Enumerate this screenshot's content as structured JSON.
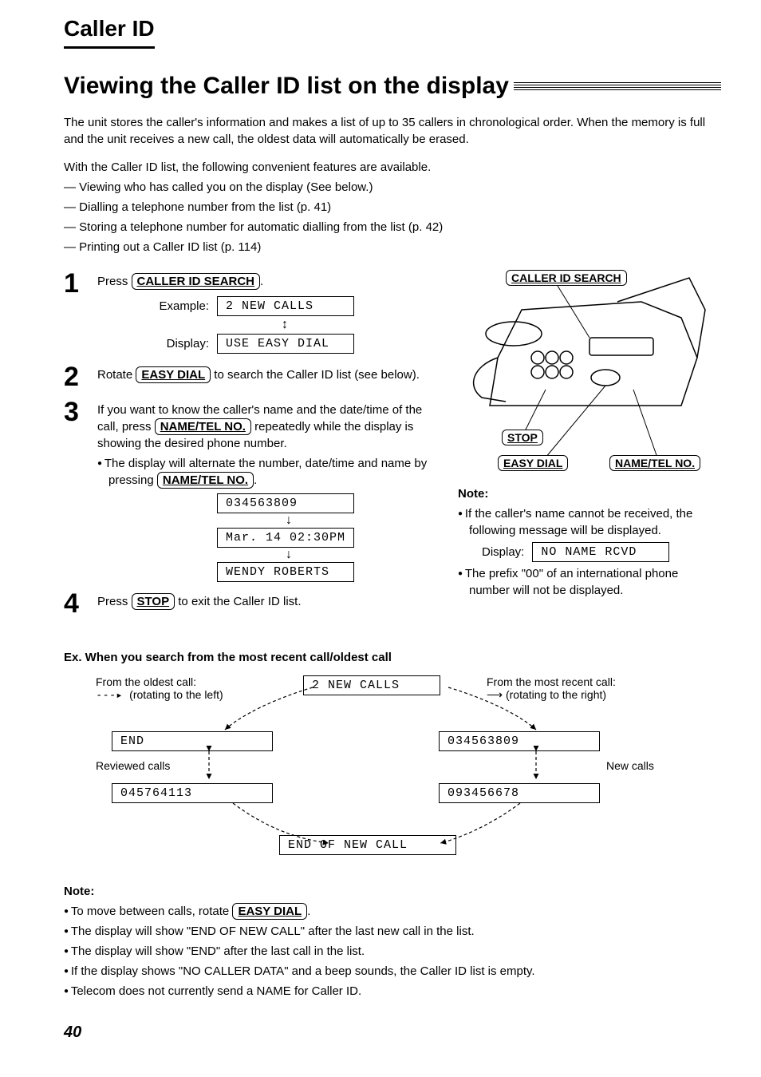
{
  "tab": "Caller ID",
  "title": "Viewing the Caller ID list on the display",
  "intro1": "The unit stores the caller's information and makes a list of up to 35 callers in chronological order. When the memory is full and the unit receives a new call, the oldest data will automatically be erased.",
  "intro2": "With the Caller ID list, the following convenient features are available.",
  "features": [
    "Viewing who has called you on the display (See below.)",
    "Dialling a telephone number from the list (p. 41)",
    "Storing a telephone number for automatic dialling from the list (p. 42)",
    "Printing out a Caller ID list (p. 114)"
  ],
  "buttons": {
    "caller_id_search": "CALLER ID SEARCH",
    "easy_dial": "EASY DIAL",
    "name_tel_no": "NAME/TEL NO.",
    "stop": "STOP"
  },
  "step1": {
    "text_pre": "Press ",
    "text_post": ".",
    "example_label": "Example:",
    "display_label": "Display:",
    "lcd1": "2 NEW CALLS",
    "lcd2": "USE EASY DIAL"
  },
  "step2": {
    "pre": "Rotate ",
    "post": " to search the Caller ID list (see below)."
  },
  "step3": {
    "line1a": "If you want to know the caller's name and the date/time of the call, press ",
    "line1b": " repeatedly while the display is showing the desired phone number.",
    "bullet_a": "The display will alternate the number, date/time and name by pressing ",
    "lcd1": "034563809",
    "lcd2": "Mar. 14 02:30PM",
    "lcd3": "WENDY ROBERTS"
  },
  "step4": {
    "pre": "Press ",
    "post": " to exit the Caller ID list."
  },
  "right_note": {
    "heading": "Note:",
    "b1a": "If the caller's name cannot be received, the following message will be displayed.",
    "disp_label": "Display:",
    "lcd": "NO NAME RCVD",
    "b2": "The prefix \"00\" of an international phone number will not be displayed."
  },
  "search_example": {
    "heading": "Ex. When you search from the most recent call/oldest call",
    "oldest_label": "From the oldest call:",
    "oldest_hint": "(rotating to the left)",
    "recent_label": "From the most recent call:",
    "recent_hint": "(rotating to the right)",
    "reviewed_label": "Reviewed calls",
    "new_calls_label": "New calls",
    "lcd_top": "2 NEW CALLS",
    "lcd_end": "END",
    "lcd_045": "045764113",
    "lcd_034": "034563809",
    "lcd_093": "093456678",
    "lcd_bottom": "END OF NEW CALL"
  },
  "bottom_note": {
    "heading": "Note:",
    "b1a": "To move between calls, rotate ",
    "b2": "The display will show \"END OF NEW CALL\" after the last new call in the list.",
    "b3": "The display will show \"END\" after the last call in the list.",
    "b4": "If the display shows \"NO CALLER DATA\" and a beep sounds, the Caller ID list is empty.",
    "b5": "Telecom does not currently send a NAME for Caller ID."
  },
  "page_number": "40"
}
